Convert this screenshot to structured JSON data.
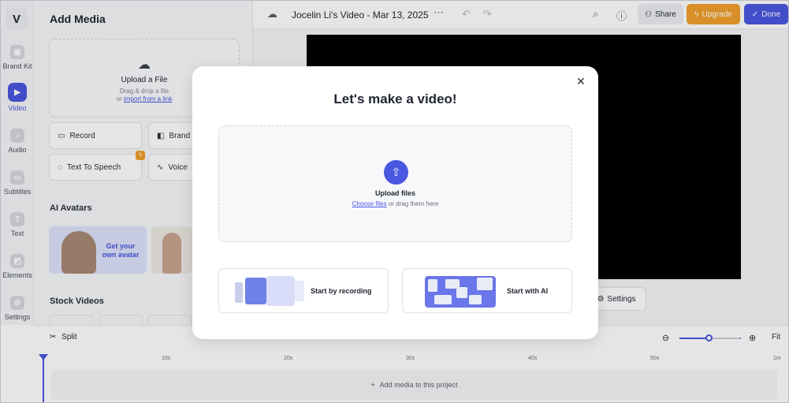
{
  "rail": {
    "logo": "V",
    "items": [
      {
        "label": "Brand Kit",
        "icon": "brand-kit-icon"
      },
      {
        "label": "Video",
        "icon": "video-icon"
      },
      {
        "label": "Audio",
        "icon": "music-note-icon"
      },
      {
        "label": "Subtitles",
        "icon": "subtitles-icon"
      },
      {
        "label": "Text",
        "icon": "text-icon"
      },
      {
        "label": "Elements",
        "icon": "elements-icon"
      },
      {
        "label": "Settings",
        "icon": "settings-icon"
      }
    ]
  },
  "panel": {
    "title": "Add Media",
    "upload": {
      "title": "Upload a File",
      "hint": "Drag & drop a file",
      "or": "or",
      "link": "import from a link"
    },
    "buttons": {
      "record": "Record",
      "brand": "Brand",
      "tts": "Text To Speech",
      "voice": "Voice"
    },
    "ai_avatars_heading": "AI Avatars",
    "avatar_cta": "Get your own avatar",
    "stock_heading": "Stock Videos"
  },
  "topbar": {
    "title": "Jocelin Li's Video - Mar 13, 2025",
    "share": "Share",
    "upgrade": "Upgrade",
    "done": "Done"
  },
  "canvas": {
    "settings": "Settings"
  },
  "timeline": {
    "split": "Split",
    "zoom_fit": "Fit",
    "zoom_level": 0.5,
    "ruler": [
      "10s",
      "20s",
      "30s",
      "40s",
      "50s",
      "1m"
    ],
    "track_hint": "Add media to this project"
  },
  "modal": {
    "title": "Let's make a video!",
    "upload_title": "Upload files",
    "choose_link": "Choose files",
    "upload_sub": " or drag them here",
    "option_record": "Start by recording",
    "option_ai": "Start with AI"
  },
  "colors": {
    "accent": "#4a57e0",
    "upgrade": "#f2a02c"
  }
}
